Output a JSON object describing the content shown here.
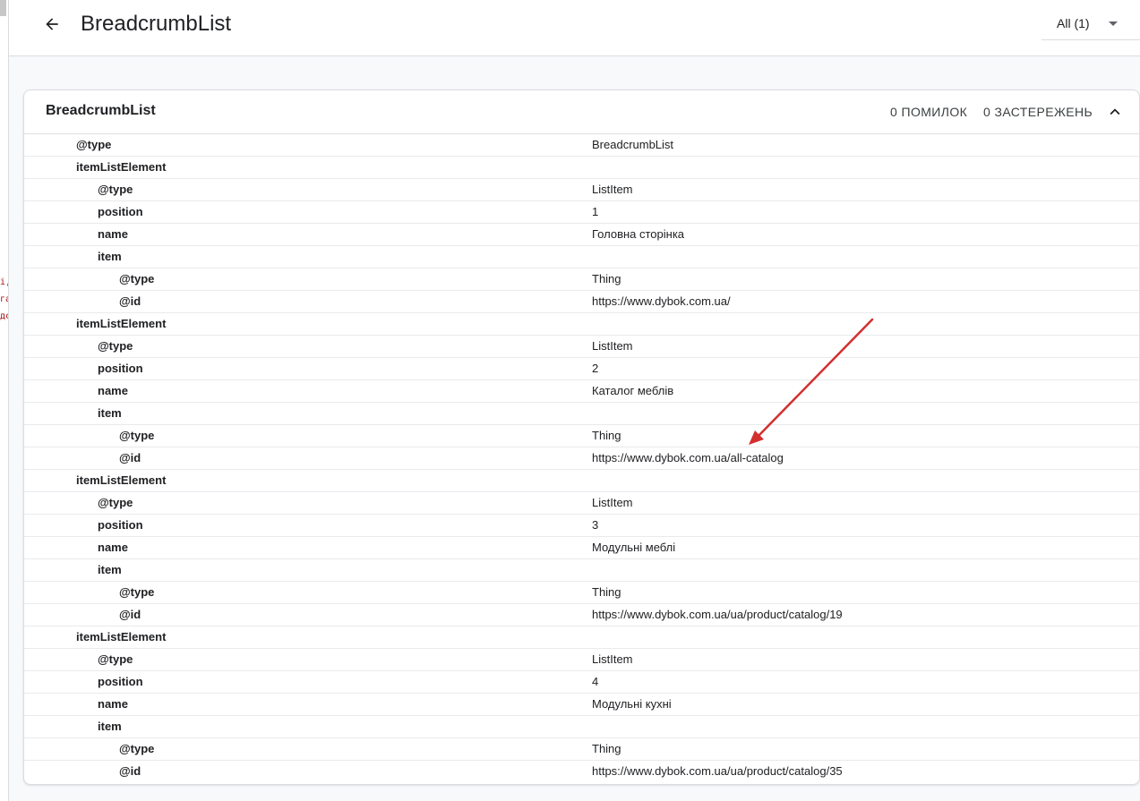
{
  "left_panel": {
    "fragments": [
      "і,",
      "га",
      "дс"
    ]
  },
  "header": {
    "title": "BreadcrumbList",
    "back_icon": "arrow-back-icon",
    "filter": {
      "selected": "All (1)",
      "icon": "caret-down-icon"
    }
  },
  "card": {
    "title": "BreadcrumbList",
    "errors_label": "0 ПОМИЛОК",
    "warnings_label": "0 ЗАСТЕРЕЖЕНЬ",
    "collapse_icon": "chevron-up-icon",
    "rows": [
      {
        "level": 0,
        "key": "@type",
        "value": "BreadcrumbList"
      },
      {
        "level": 0,
        "key": "itemListElement",
        "value": ""
      },
      {
        "level": 1,
        "key": "@type",
        "value": "ListItem"
      },
      {
        "level": 1,
        "key": "position",
        "value": "1"
      },
      {
        "level": 1,
        "key": "name",
        "value": "Головна сторінка"
      },
      {
        "level": 1,
        "key": "item",
        "value": ""
      },
      {
        "level": 2,
        "key": "@type",
        "value": "Thing"
      },
      {
        "level": 2,
        "key": "@id",
        "value": "https://www.dybok.com.ua/"
      },
      {
        "level": 0,
        "key": "itemListElement",
        "value": ""
      },
      {
        "level": 1,
        "key": "@type",
        "value": "ListItem"
      },
      {
        "level": 1,
        "key": "position",
        "value": "2"
      },
      {
        "level": 1,
        "key": "name",
        "value": "Каталог меблів"
      },
      {
        "level": 1,
        "key": "item",
        "value": ""
      },
      {
        "level": 2,
        "key": "@type",
        "value": "Thing"
      },
      {
        "level": 2,
        "key": "@id",
        "value": "https://www.dybok.com.ua/all-catalog"
      },
      {
        "level": 0,
        "key": "itemListElement",
        "value": ""
      },
      {
        "level": 1,
        "key": "@type",
        "value": "ListItem"
      },
      {
        "level": 1,
        "key": "position",
        "value": "3"
      },
      {
        "level": 1,
        "key": "name",
        "value": "Модульні меблі"
      },
      {
        "level": 1,
        "key": "item",
        "value": ""
      },
      {
        "level": 2,
        "key": "@type",
        "value": "Thing"
      },
      {
        "level": 2,
        "key": "@id",
        "value": "https://www.dybok.com.ua/ua/product/catalog/19"
      },
      {
        "level": 0,
        "key": "itemListElement",
        "value": ""
      },
      {
        "level": 1,
        "key": "@type",
        "value": "ListItem"
      },
      {
        "level": 1,
        "key": "position",
        "value": "4"
      },
      {
        "level": 1,
        "key": "name",
        "value": "Модульні кухні"
      },
      {
        "level": 1,
        "key": "item",
        "value": ""
      },
      {
        "level": 2,
        "key": "@type",
        "value": "Thing"
      },
      {
        "level": 2,
        "key": "@id",
        "value": "https://www.dybok.com.ua/ua/product/catalog/35"
      }
    ]
  },
  "annotation": {
    "icon": "red-arrow-icon",
    "color": "#d32f2f"
  }
}
